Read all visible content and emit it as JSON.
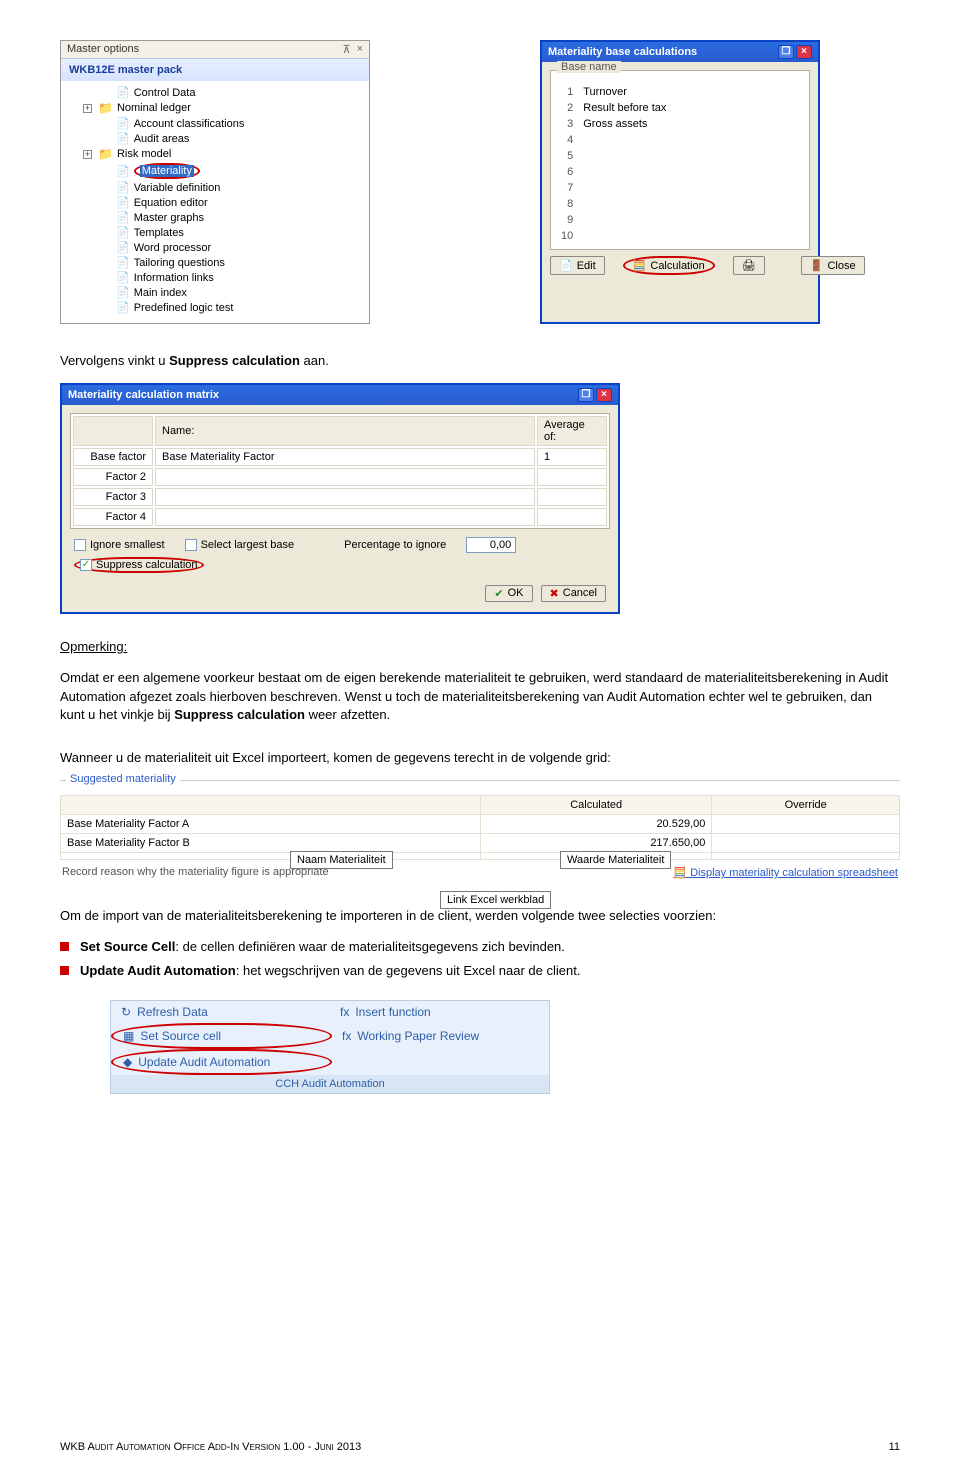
{
  "tree": {
    "header": "Master options",
    "header_icons": [
      "pin-icon",
      "close-icon"
    ],
    "pack": "WKB12E master pack",
    "items": [
      {
        "icon": "doc",
        "expand": "",
        "label": "Control Data"
      },
      {
        "icon": "folder",
        "expand": "+",
        "label": "Nominal ledger"
      },
      {
        "icon": "doc",
        "expand": "",
        "label": "Account classifications"
      },
      {
        "icon": "doc",
        "expand": "",
        "label": "Audit areas"
      },
      {
        "icon": "folder",
        "expand": "+",
        "label": "Risk model"
      },
      {
        "icon": "doc",
        "expand": "",
        "label": "Materiality",
        "selected": true,
        "highlight": true
      },
      {
        "icon": "doc",
        "expand": "",
        "label": "Variable definition"
      },
      {
        "icon": "doc",
        "expand": "",
        "label": "Equation editor"
      },
      {
        "icon": "doc",
        "expand": "",
        "label": "Master graphs"
      },
      {
        "icon": "doc",
        "expand": "",
        "label": "Templates"
      },
      {
        "icon": "doc",
        "expand": "",
        "label": "Word processor"
      },
      {
        "icon": "doc",
        "expand": "",
        "label": "Tailoring questions"
      },
      {
        "icon": "doc",
        "expand": "",
        "label": "Information links"
      },
      {
        "icon": "doc",
        "expand": "",
        "label": "Main index"
      },
      {
        "icon": "doc",
        "expand": "",
        "label": "Predefined logic test"
      }
    ]
  },
  "calc_dialog": {
    "title": "Materiality base calculations",
    "legend": "Base name",
    "rows": [
      {
        "n": "1",
        "v": "Turnover"
      },
      {
        "n": "2",
        "v": "Result before tax"
      },
      {
        "n": "3",
        "v": "Gross assets"
      },
      {
        "n": "4",
        "v": ""
      },
      {
        "n": "5",
        "v": ""
      },
      {
        "n": "6",
        "v": ""
      },
      {
        "n": "7",
        "v": ""
      },
      {
        "n": "8",
        "v": ""
      },
      {
        "n": "9",
        "v": ""
      },
      {
        "n": "10",
        "v": ""
      }
    ],
    "buttons": {
      "edit": "Edit",
      "calculation": "Calculation",
      "print": "",
      "close": "Close"
    }
  },
  "p1": "Vervolgens vinkt u ",
  "p1b": "Suppress calculation",
  "p1c": " aan.",
  "matrix": {
    "title": "Materiality calculation matrix",
    "head_name": "Name:",
    "head_avg": "Average of:",
    "rows": [
      "Base factor",
      "Factor 2",
      "Factor 3",
      "Factor 4"
    ],
    "cell_name": "Base Materiality Factor",
    "cell_avg": "1",
    "chk_ignore": "Ignore smallest",
    "chk_largest": "Select largest base",
    "pct_label": "Percentage to ignore",
    "pct_value": "0,00",
    "chk_suppress": "Suppress calculation",
    "ok": "OK",
    "cancel": "Cancel"
  },
  "opm_h": "Opmerking:",
  "opm_b": "Omdat er een algemene voorkeur bestaat om de eigen berekende materialiteit te gebruiken, werd standaard de materialiteitsberekening in Audit Automation afgezet zoals hierboven beschreven. Wenst u toch de materialiteitsberekening van Audit Automation echter wel te gebruiken, dan kunt u het vinkje bij ",
  "opm_b2": " weer afzetten.",
  "p2": "Wanneer u de materialiteit uit Excel importeert, komen de gegevens terecht in de volgende grid:",
  "sugg": {
    "legend": "Suggested materiality",
    "th_calc": "Calculated",
    "th_over": "Override",
    "row_a": "Base Materiality Factor A",
    "val_a": "20.529,00",
    "row_b": "Base Materiality Factor B",
    "val_b": "217.650,00",
    "foot": "Record reason why the materiality figure is appropriate",
    "link": "Display materiality calculation spreadsheet",
    "ann1": "Naam Materialiteit",
    "ann2": "Waarde Materialiteit",
    "ann3": "Link Excel werkblad"
  },
  "p3": "Om de import van de materialiteitsberekening te importeren in de client, werden volgende twee selecties voorzien:",
  "b1a": "Set Source Cell",
  "b1b": ": de cellen definiëren waar de materialiteitsgegevens zich bevinden.",
  "b2a": "Update Audit Automation",
  "b2b": ": het wegschrijven van de gegevens uit Excel naar de client.",
  "ribbon": {
    "cells": [
      {
        "i": "↻",
        "t": "Refresh Data"
      },
      {
        "i": "fx",
        "t": "Insert function"
      },
      {
        "i": "▦",
        "t": "Set Source cell",
        "hl": true
      },
      {
        "i": "fx",
        "t": "Working Paper Review"
      },
      {
        "i": "◆",
        "t": "Update Audit Automation",
        "hl": true
      }
    ],
    "foot": "CCH Audit Automation"
  },
  "footer_l": "WKB Audit Automation Office Add-In Version 1.00 - Juni 2013",
  "footer_r": "11"
}
